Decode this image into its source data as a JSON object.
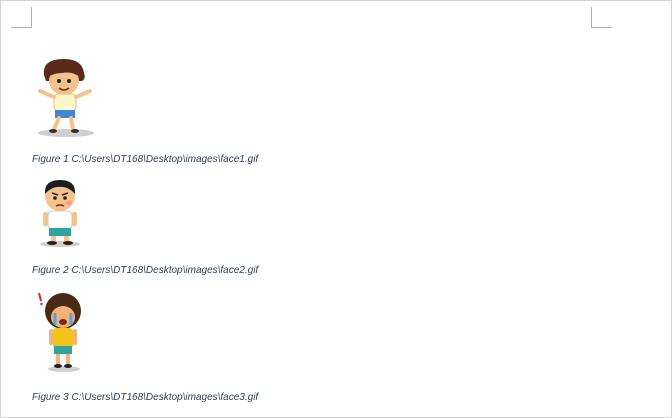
{
  "figures": [
    {
      "caption": "Figure 1 C:\\Users\\DT168\\Desktop\\images\\face1.gif",
      "icon": "cartoon-boy-dancing"
    },
    {
      "caption": "Figure 2 C:\\Users\\DT168\\Desktop\\images\\face2.gif",
      "icon": "cartoon-boy-angry"
    },
    {
      "caption": "Figure 3 C:\\Users\\DT168\\Desktop\\images\\face3.gif",
      "icon": "cartoon-boy-crying"
    }
  ]
}
